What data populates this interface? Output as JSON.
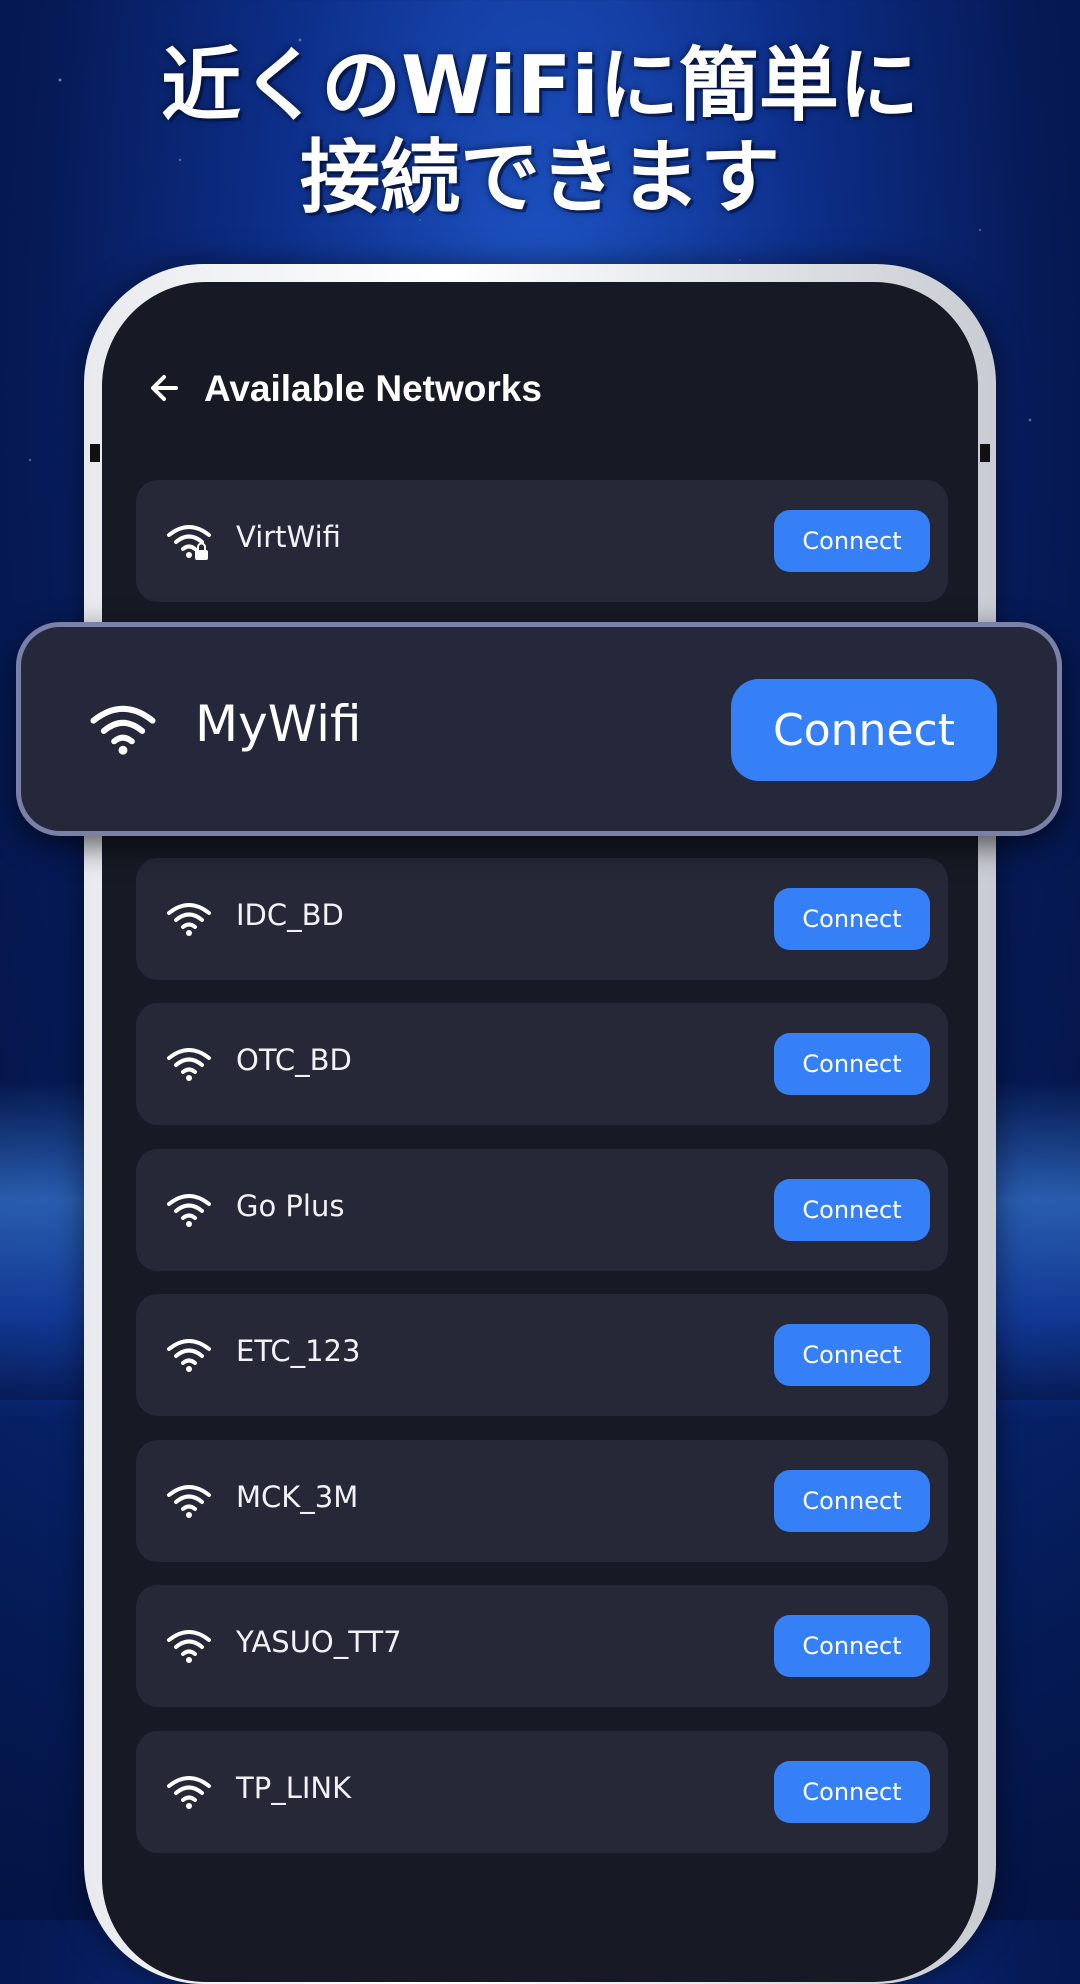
{
  "headline": {
    "line1": "近くのWiFiに簡単に",
    "line2": "接続できます"
  },
  "appbar": {
    "title": "Available Networks",
    "back_icon": "arrow-left-icon"
  },
  "featured": {
    "name": "MyWifi",
    "connect_label": "Connect",
    "icon": "wifi-icon"
  },
  "networks": [
    {
      "name": "VirtWifi",
      "connect_label": "Connect",
      "icon": "wifi-lock-icon"
    },
    {
      "name": "IDC_BD",
      "connect_label": "Connect",
      "icon": "wifi-icon"
    },
    {
      "name": "OTC_BD",
      "connect_label": "Connect",
      "icon": "wifi-icon"
    },
    {
      "name": "Go Plus",
      "connect_label": "Connect",
      "icon": "wifi-icon"
    },
    {
      "name": "ETC_123",
      "connect_label": "Connect",
      "icon": "wifi-icon"
    },
    {
      "name": "MCK_3M",
      "connect_label": "Connect",
      "icon": "wifi-icon"
    },
    {
      "name": "YASUO_TT7",
      "connect_label": "Connect",
      "icon": "wifi-icon"
    },
    {
      "name": "TP_LINK",
      "connect_label": "Connect",
      "icon": "wifi-icon"
    }
  ],
  "colors": {
    "accent": "#3680f7",
    "card": "#262838",
    "screen": "#171925"
  }
}
